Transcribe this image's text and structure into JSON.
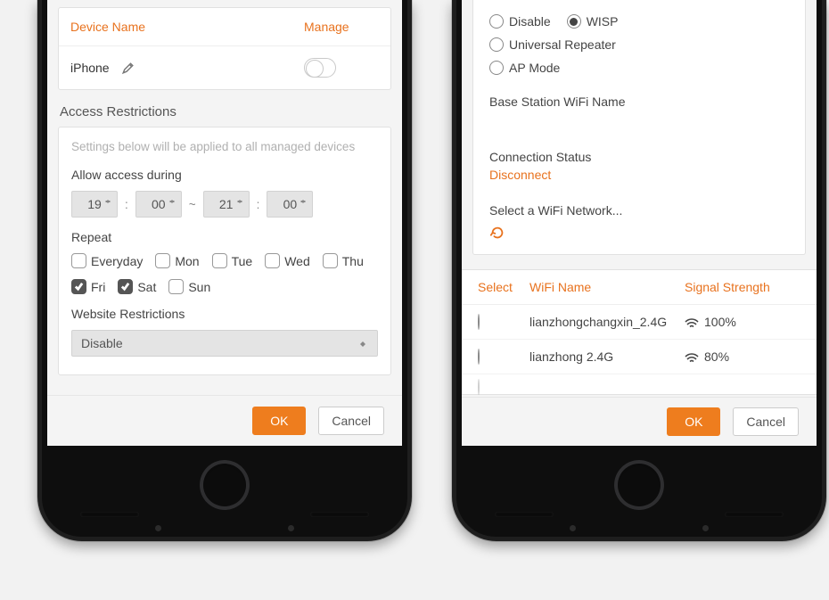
{
  "left": {
    "devtbl": {
      "h_name": "Device Name",
      "h_manage": "Manage",
      "row1": "iPhone"
    },
    "sec_title": "Access Restrictions",
    "note": "Settings below will be applied to all managed devices",
    "allow_label": "Allow access during",
    "time": {
      "h1": "19",
      "m1": "00",
      "h2": "21",
      "m2": "00",
      "sep": "~",
      "colon": ":"
    },
    "repeat_label": "Repeat",
    "days": {
      "every": "Everyday",
      "mon": "Mon",
      "tue": "Tue",
      "wed": "Wed",
      "thu": "Thu",
      "fri": "Fri",
      "sat": "Sat",
      "sun": "Sun"
    },
    "wr_label": "Website Restrictions",
    "wr_value": "Disable",
    "btn_ok": "OK",
    "btn_cancel": "Cancel"
  },
  "right": {
    "modes": {
      "disable": "Disable",
      "wisp": "WISP",
      "ur": "Universal Repeater",
      "ap": "AP Mode"
    },
    "bs_label": "Base Station WiFi Name",
    "cs_label": "Connection Status",
    "cs_value": "Disconnect",
    "select_label": "Select a WiFi Network...",
    "tbl": {
      "h_sel": "Select",
      "h_name": "WiFi Name",
      "h_sig": "Signal Strength"
    },
    "rows": [
      {
        "name": "lianzhongchangxin_2.4G",
        "sig": "100%"
      },
      {
        "name": "lianzhong 2.4G",
        "sig": "80%"
      }
    ],
    "btn_ok": "OK",
    "btn_cancel": "Cancel"
  }
}
